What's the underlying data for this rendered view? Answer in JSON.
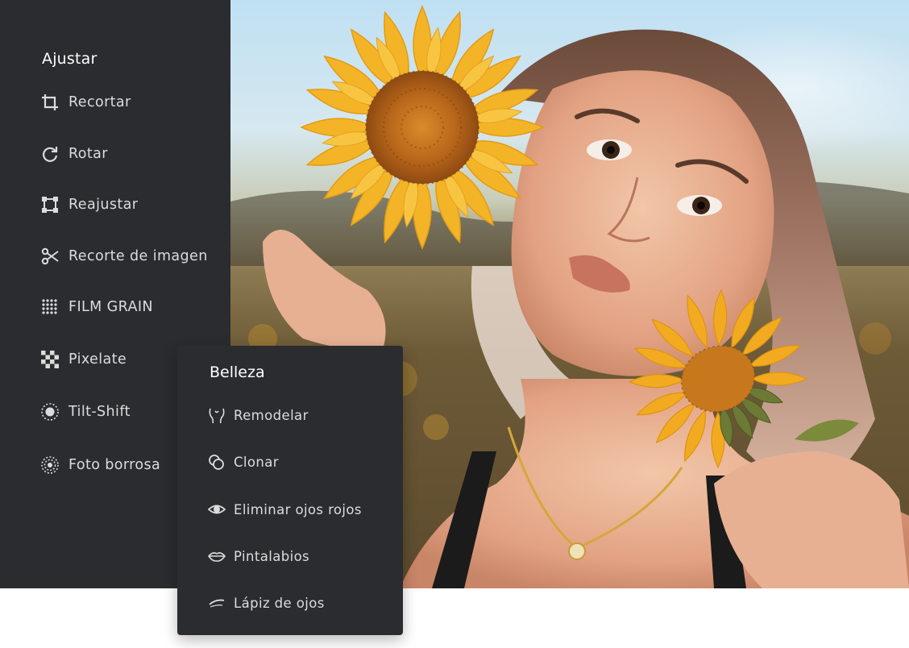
{
  "adjust_panel": {
    "title": "Ajustar",
    "items": [
      {
        "label": "Recortar",
        "icon": "crop-icon"
      },
      {
        "label": "Rotar",
        "icon": "rotate-icon"
      },
      {
        "label": "Reajustar",
        "icon": "resize-icon"
      },
      {
        "label": "Recorte de imagen",
        "icon": "scissors-icon"
      },
      {
        "label": "FILM GRAIN",
        "icon": "film-grain-icon"
      },
      {
        "label": "Pixelate",
        "icon": "pixelate-icon"
      },
      {
        "label": "Tilt-Shift",
        "icon": "tilt-shift-icon"
      },
      {
        "label": "Foto borrosa",
        "icon": "blur-icon"
      }
    ]
  },
  "beauty_panel": {
    "title": "Belleza",
    "items": [
      {
        "label": "Remodelar",
        "icon": "reshape-icon"
      },
      {
        "label": "Clonar",
        "icon": "clone-icon"
      },
      {
        "label": "Eliminar ojos rojos",
        "icon": "eye-icon"
      },
      {
        "label": "Pintalabios",
        "icon": "lips-icon"
      },
      {
        "label": "Lápiz de ojos",
        "icon": "eyeliner-icon"
      }
    ]
  },
  "colors": {
    "panel_bg": "#2b2c2f",
    "text": "#dcdcdc",
    "title": "#ffffff",
    "sunflower_petal": "#f4b427",
    "sunflower_center": "#b8661a"
  }
}
